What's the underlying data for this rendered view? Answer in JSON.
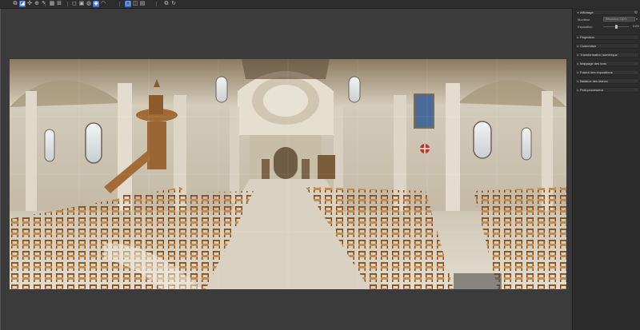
{
  "toolbar": {
    "buttons": [
      {
        "name": "layers-icon",
        "glyph": "⧉",
        "active": false
      },
      {
        "name": "select-icon",
        "glyph": "◪",
        "active": true
      },
      {
        "name": "move-icon",
        "glyph": "✣",
        "active": false
      },
      {
        "name": "zoom-icon",
        "glyph": "⊕",
        "active": false
      },
      {
        "name": "wand-icon",
        "glyph": "✎",
        "active": false
      },
      {
        "name": "grid-icon",
        "glyph": "▦",
        "active": false
      },
      {
        "name": "link-icon",
        "glyph": "⊞",
        "active": false
      },
      {
        "name": "frame-icon",
        "glyph": "◻",
        "active": false
      },
      {
        "name": "crop-icon",
        "glyph": "▣",
        "active": false
      },
      {
        "name": "sphere-icon",
        "glyph": "◍",
        "active": false
      },
      {
        "name": "globe-icon",
        "glyph": "◉",
        "active": true
      },
      {
        "name": "eye-icon",
        "glyph": "◠",
        "active": false
      },
      {
        "name": "view-single-icon",
        "glyph": "▢",
        "active": true
      },
      {
        "name": "view-split-icon",
        "glyph": "◫",
        "active": false
      },
      {
        "name": "info-icon",
        "glyph": "▤",
        "active": false
      },
      {
        "name": "copy-icon",
        "glyph": "⧉",
        "active": false
      },
      {
        "name": "refresh-icon",
        "glyph": "↻",
        "active": false
      }
    ]
  },
  "panel": {
    "display_section": {
      "label": "Affichage",
      "monitor_label": "Moniteur",
      "monitor_value": "Résolution 100%",
      "exposure_label": "Exposition",
      "exposure_value": "0 EV",
      "exposure_level": 0.5
    },
    "sections": [
      "Projection",
      "Customiser",
      "Transformation numérique",
      "Mappage des tons",
      "Fusion des expositions",
      "Balance des blancs",
      "Post-processeur"
    ]
  },
  "colors": {
    "accent": "#3b6fd4",
    "panel_bg": "#2c2c2c",
    "canvas_bg": "#3b3b3b"
  }
}
